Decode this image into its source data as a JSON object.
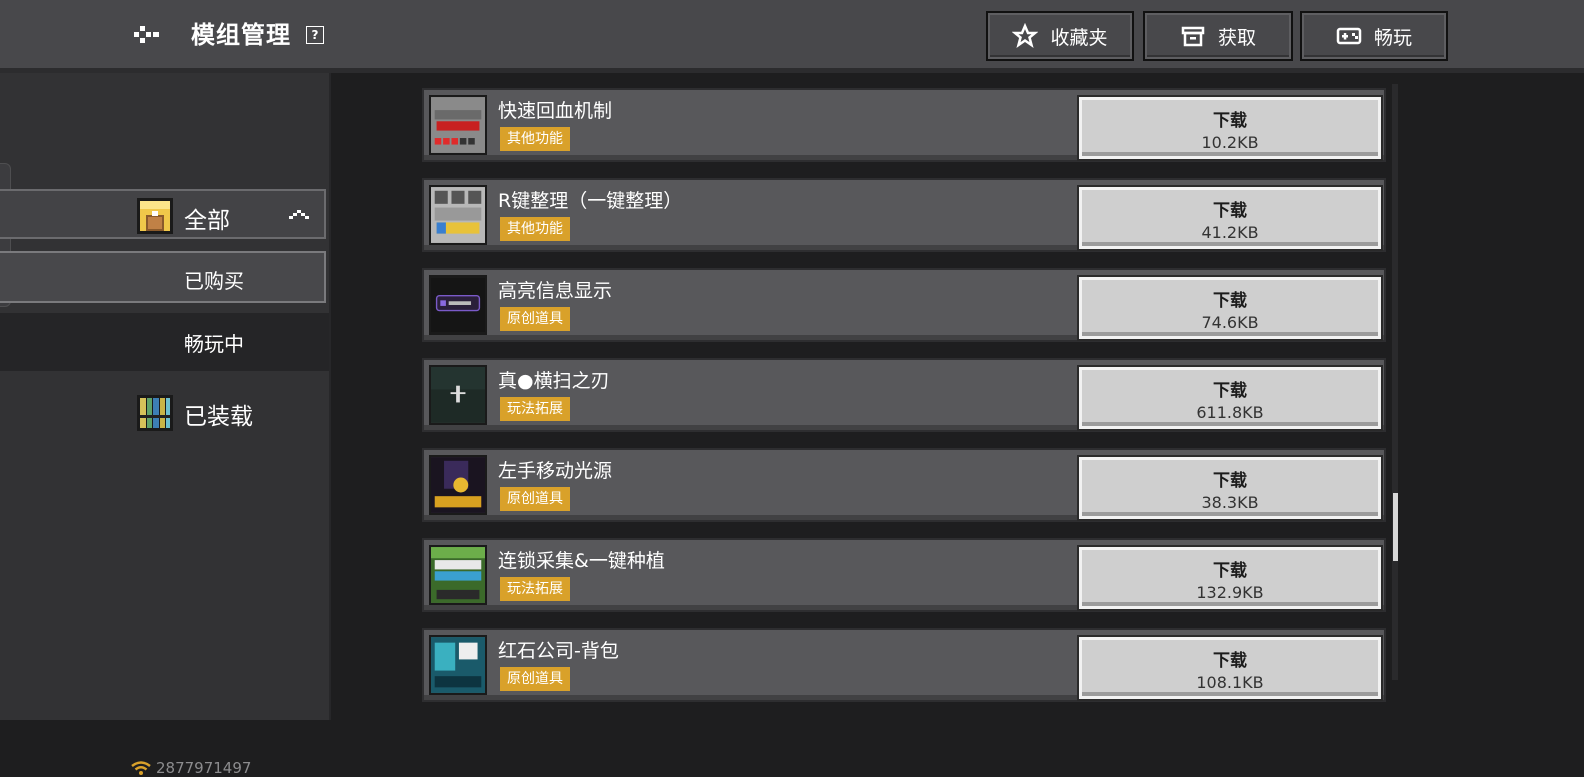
{
  "header": {
    "title": "模组管理",
    "help": "?",
    "buttons": [
      {
        "label": "收藏夹",
        "icon": "star-icon"
      },
      {
        "label": "获取",
        "icon": "box-icon"
      },
      {
        "label": "畅玩",
        "icon": "gamepad-icon"
      }
    ]
  },
  "sidebar": {
    "all_label": "全部",
    "bought_label": "已购买",
    "playing_label": "畅玩中",
    "loaded_label": "已装载",
    "user_id": "2877971497"
  },
  "mods": [
    {
      "name": "快速回血机制",
      "tag": "其他功能",
      "action": "下载",
      "size": "10.2KB"
    },
    {
      "name": "R键整理（一键整理）",
      "tag": "其他功能",
      "action": "下载",
      "size": "41.2KB"
    },
    {
      "name": "高亮信息显示",
      "tag": "原创道具",
      "action": "下载",
      "size": "74.6KB"
    },
    {
      "name": "真●横扫之刃",
      "tag": "玩法拓展",
      "action": "下载",
      "size": "611.8KB"
    },
    {
      "name": "左手移动光源",
      "tag": "原创道具",
      "action": "下载",
      "size": "38.3KB"
    },
    {
      "name": "连锁采集&一键种植",
      "tag": "玩法拓展",
      "action": "下载",
      "size": "132.9KB"
    },
    {
      "name": "红石公司-背包",
      "tag": "原创道具",
      "action": "下载",
      "size": "108.1KB"
    }
  ],
  "colors": {
    "tag": "#d9a12a",
    "accent_button": "#cfcfcf",
    "header": "#48484b"
  }
}
